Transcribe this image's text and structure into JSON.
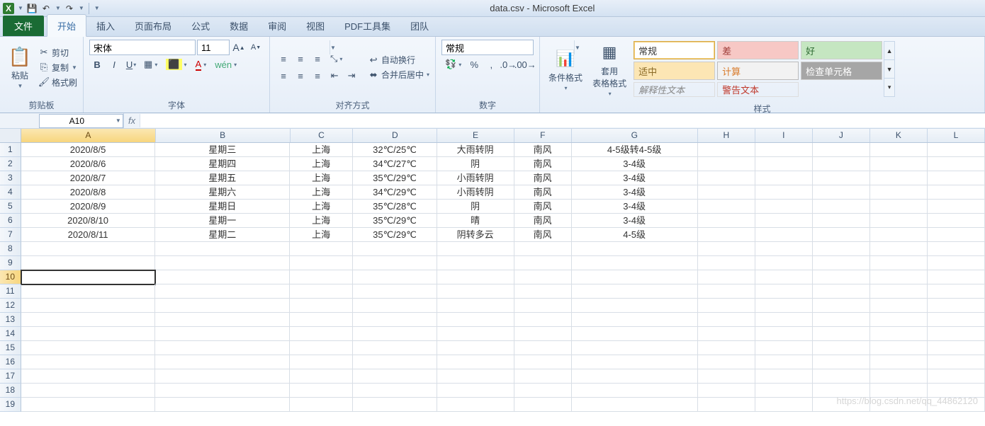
{
  "app": {
    "title": "data.csv  -  Microsoft Excel"
  },
  "tabs": {
    "file": "文件",
    "home": "开始",
    "insert": "插入",
    "layout": "页面布局",
    "formulas": "公式",
    "data": "数据",
    "review": "审阅",
    "view": "视图",
    "pdf": "PDF工具集",
    "team": "团队"
  },
  "clipboard": {
    "paste": "粘贴",
    "cut": "剪切",
    "copy": "复制",
    "painter": "格式刷",
    "group": "剪贴板"
  },
  "font": {
    "name": "宋体",
    "size": "11",
    "group": "字体"
  },
  "align": {
    "wrap": "自动换行",
    "merge": "合并后居中",
    "group": "对齐方式"
  },
  "number": {
    "format": "常规",
    "group": "数字"
  },
  "styles": {
    "cond": "条件格式",
    "table": "套用\n表格格式",
    "group": "样式",
    "normal": "常规",
    "bad": "差",
    "good": "好",
    "neutral": "适中",
    "calc": "计算",
    "check": "检查单元格",
    "expl": "解释性文本",
    "warn": "警告文本"
  },
  "namebox": "A10",
  "columns": [
    "A",
    "B",
    "C",
    "D",
    "E",
    "F",
    "G",
    "H",
    "I",
    "J",
    "K",
    "L"
  ],
  "colClasses": [
    "colA",
    "colB",
    "colC",
    "colD",
    "colE",
    "colF",
    "colG",
    "colH",
    "colI",
    "colJ",
    "colK",
    "colL"
  ],
  "rowCount": 19,
  "activeCell": {
    "row": 10,
    "col": 0
  },
  "data": [
    [
      "2020/8/5",
      "星期三",
      "上海",
      "32℃/25℃",
      "大雨转阴",
      "南风",
      "4-5级转4-5级",
      "",
      "",
      "",
      "",
      ""
    ],
    [
      "2020/8/6",
      "星期四",
      "上海",
      "34℃/27℃",
      "阴",
      "南风",
      "3-4级",
      "",
      "",
      "",
      "",
      ""
    ],
    [
      "2020/8/7",
      "星期五",
      "上海",
      "35℃/29℃",
      "小雨转阴",
      "南风",
      "3-4级",
      "",
      "",
      "",
      "",
      ""
    ],
    [
      "2020/8/8",
      "星期六",
      "上海",
      "34℃/29℃",
      "小雨转阴",
      "南风",
      "3-4级",
      "",
      "",
      "",
      "",
      ""
    ],
    [
      "2020/8/9",
      "星期日",
      "上海",
      "35℃/28℃",
      "阴",
      "南风",
      "3-4级",
      "",
      "",
      "",
      "",
      ""
    ],
    [
      "2020/8/10",
      "星期一",
      "上海",
      "35℃/29℃",
      "晴",
      "南风",
      "3-4级",
      "",
      "",
      "",
      "",
      ""
    ],
    [
      "2020/8/11",
      "星期二",
      "上海",
      "35℃/29℃",
      "阴转多云",
      "南风",
      "4-5级",
      "",
      "",
      "",
      "",
      ""
    ]
  ],
  "watermark": "https://blog.csdn.net/qq_44862120"
}
